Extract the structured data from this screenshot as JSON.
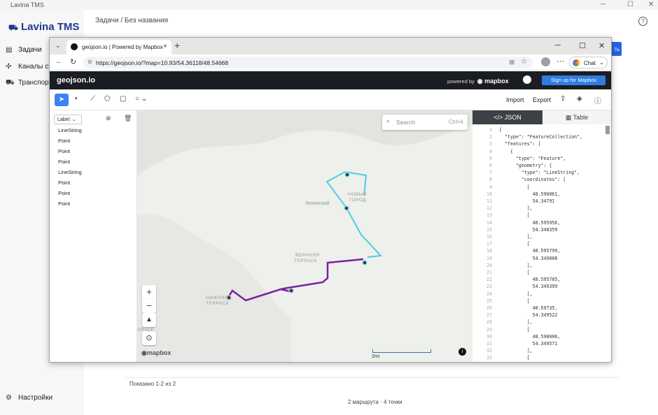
{
  "bg_app": {
    "window_title": "Lavina TMS",
    "brand": "Lavina TMS",
    "breadcrumb": "Задачи / Без названия",
    "nav": [
      {
        "label": "Задачи",
        "icon": "tasks-icon"
      },
      {
        "label": "Каналы свя",
        "icon": "channels-icon"
      },
      {
        "label": "Транспорт",
        "icon": "truck-icon"
      }
    ],
    "settings_label": "Настройки",
    "blue_button_label": "ть",
    "shown_text": "Показано 1-2 из 2",
    "footer_status": "2 маршрута · 4 точки"
  },
  "browser": {
    "tab_title": "geojson.io | Powered by Mapbox",
    "url": "https://geojson.io/?map=10.93/54.36118/48.54668",
    "chat_label": "Chat"
  },
  "geojson": {
    "logo": "geojson.io",
    "powered_by": "powered by",
    "mapbox": "mapbox",
    "signup": "Sign up for Mapbox",
    "import": "Import",
    "export": "Export",
    "label_select": "Label:",
    "features": [
      "LineString",
      "Point",
      "Point",
      "Point",
      "LineString",
      "Point",
      "Point",
      "Point"
    ],
    "search_placeholder": "Search",
    "search_shortcut": "Ctrl+k",
    "scale_label": "2mi",
    "mapbox_logo": "mapbox",
    "map_labels": [
      {
        "text": "Ленинский"
      },
      {
        "text": "НОВЫЙ"
      },
      {
        "text": "ГОРОД"
      },
      {
        "text": "ВЕРХНЯЯ"
      },
      {
        "text": "ТЕРРАСА"
      },
      {
        "text": "НИЖНЯЯ"
      },
      {
        "text": "ТЕРРАСА"
      },
      {
        "text": "ЛЯЧЬЕ"
      }
    ],
    "tab_json": "JSON",
    "tab_table": "Table",
    "code_lines": [
      {
        "n": "1",
        "t": "{"
      },
      {
        "n": "2",
        "t": "  \"type\": \"FeatureCollection\","
      },
      {
        "n": "3",
        "t": "  \"features\": ["
      },
      {
        "n": "4",
        "t": "    {"
      },
      {
        "n": "5",
        "t": "      \"type\": \"Feature\","
      },
      {
        "n": "6",
        "t": "      \"geometry\": {"
      },
      {
        "n": "7",
        "t": "        \"type\": \"LineString\","
      },
      {
        "n": "8",
        "t": "        \"coordinates\": ["
      },
      {
        "n": "9",
        "t": "          ["
      },
      {
        "n": "10",
        "t": "            48.596061,"
      },
      {
        "n": "11",
        "t": "            54.34791"
      },
      {
        "n": "12",
        "t": "          ],"
      },
      {
        "n": "13",
        "t": "          ["
      },
      {
        "n": "14",
        "t": "            48.595956,"
      },
      {
        "n": "15",
        "t": "            54.348359"
      },
      {
        "n": "16",
        "t": "          ],"
      },
      {
        "n": "17",
        "t": "          ["
      },
      {
        "n": "18",
        "t": "            48.595799,"
      },
      {
        "n": "19",
        "t": "            54.349008"
      },
      {
        "n": "20",
        "t": "          ],"
      },
      {
        "n": "21",
        "t": "          ["
      },
      {
        "n": "22",
        "t": "            48.595705,"
      },
      {
        "n": "23",
        "t": "            54.349399"
      },
      {
        "n": "24",
        "t": "          ],"
      },
      {
        "n": "25",
        "t": "          ["
      },
      {
        "n": "26",
        "t": "            48.59735,"
      },
      {
        "n": "27",
        "t": "            54.349522"
      },
      {
        "n": "28",
        "t": "          ],"
      },
      {
        "n": "29",
        "t": "          ["
      },
      {
        "n": "30",
        "t": "            48.598006,"
      },
      {
        "n": "31",
        "t": "            54.349571"
      },
      {
        "n": "32",
        "t": "          ],"
      },
      {
        "n": "33",
        "t": "          ["
      }
    ]
  },
  "colors": {
    "route_cyan": "#4ecde6",
    "route_purple": "#7b1fa2",
    "accent": "#2f7ce2"
  }
}
